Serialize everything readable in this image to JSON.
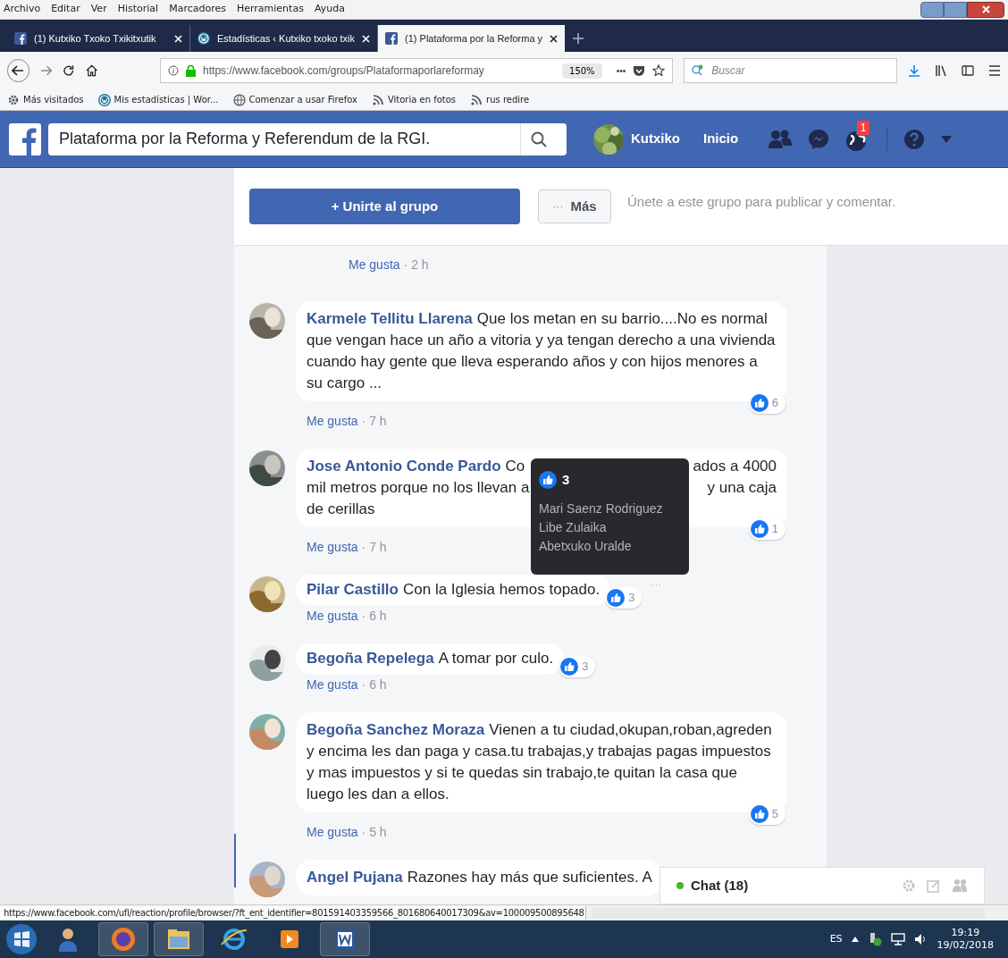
{
  "menu_bar": [
    "Archivo",
    "Editar",
    "Ver",
    "Historial",
    "Marcadores",
    "Herramientas",
    "Ayuda"
  ],
  "tabs": [
    {
      "label": "(1) Kutxiko Txoko Txikitxutik",
      "selected": false
    },
    {
      "label": "Estadísticas ‹ Kutxiko txoko txik",
      "selected": false
    },
    {
      "label": "(1) Plataforma por la Reforma y",
      "selected": true
    }
  ],
  "nav": {
    "url": "https://www.facebook.com/groups/Plataformaporlareformay",
    "zoom": "150%",
    "more": "•••",
    "search_placeholder": "Buscar"
  },
  "bookmarks": [
    "Más visitados",
    "Mis estadísticas | Wor...",
    "Comenzar a usar Firefox",
    "Vitoria en fotos",
    "rus redire"
  ],
  "facebook_bar": {
    "search_value": "Plataforma por la Reforma y Referendum de la RGI.",
    "user": "Kutxiko",
    "home": "Inicio",
    "notification_count": "1"
  },
  "join_panel": {
    "join_button": "+ Unirte al grupo",
    "more_dots": "···",
    "more_button": "Más",
    "hint": "Únete a este grupo para publicar y comentar."
  },
  "previous_meta": {
    "like": "Me gusta",
    "time": "· 2 h"
  },
  "comments": [
    {
      "kind": "long",
      "author": "Karmele Tellitu Llarena",
      "text": "Que los metan en su barrio....No es normal que vengan hace un año a vitoria y ya tengan derecho a una vivienda cuando hay gente que lleva esperando años y con hijos menores a su cargo ...",
      "reactions": "6",
      "like": "Me gusta",
      "time": "· 7 h"
    },
    {
      "kind": "covered",
      "author": "Jose Antonio Conde Pardo",
      "lines": [
        [
          "Co",
          "ados a 4000"
        ],
        [
          "mil metros porque no los llevan a",
          "y una caja"
        ],
        [
          "de cerillas"
        ]
      ],
      "reactions": "1",
      "like": "Me gusta",
      "time": "· 7 h",
      "tooltip": {
        "count": "3",
        "names": [
          "Mari Saenz Rodriguez",
          "Libe Zulaika",
          "Abetxuko Uralde"
        ]
      }
    },
    {
      "kind": "short",
      "author": "Pilar Castillo",
      "text": "Con la Iglesia hemos topado.",
      "reactions": "3",
      "options": "···",
      "like": "Me gusta",
      "time": "· 6 h"
    },
    {
      "kind": "short",
      "author": "Begoña Repelega",
      "text": "A tomar por culo.",
      "reactions": "3",
      "like": "Me gusta",
      "time": "· 6 h"
    },
    {
      "kind": "long",
      "author": "Begoña Sanchez Moraza",
      "text": "Vienen a tu ciudad,okupan,roban,agreden y encima les dan paga y casa.tu trabajas,y trabajas pagas impuestos y mas impuestos y si te quedas sin trabajo,te quitan la casa que luego les dan a ellos.",
      "reactions": "5",
      "like": "Me gusta",
      "time": "· 5 h"
    },
    {
      "kind": "long",
      "author": "Angel Pujana",
      "text": "Razones hay más que suficientes. A"
    }
  ],
  "chat": {
    "label": "Chat (18)",
    "online": true
  },
  "status_url": "https://www.facebook.com/ufi/reaction/profile/browser/?ft_ent_identifier=801591403359566_801680640017309&av=100009500895648",
  "tray": {
    "language": "ES",
    "time": "19:19",
    "date": "19/02/2018"
  }
}
